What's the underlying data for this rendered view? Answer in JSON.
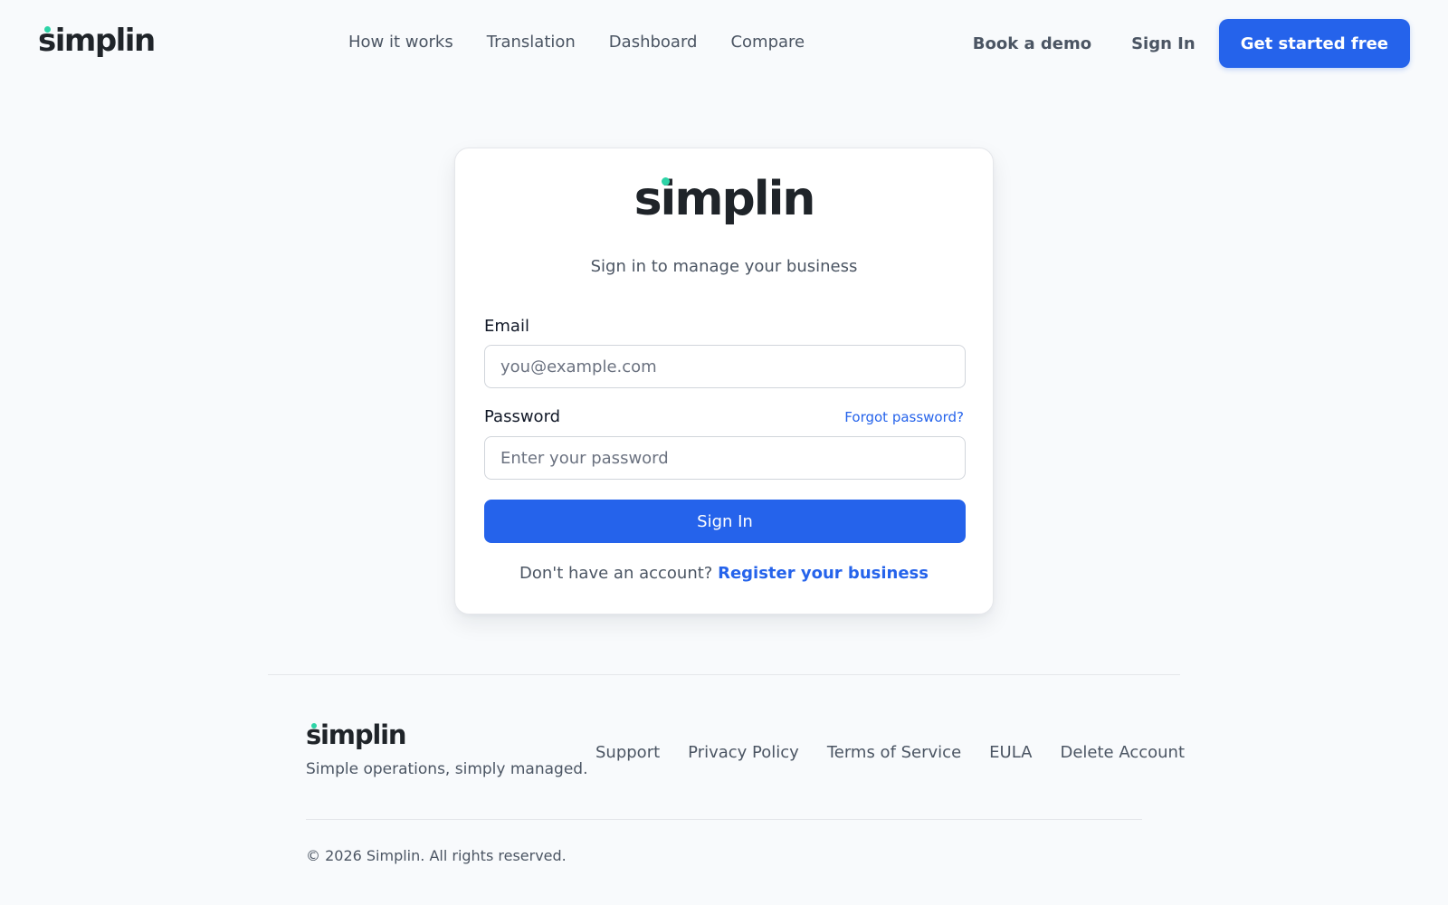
{
  "brand": {
    "logo_text": "simplin",
    "accent_dot_color": "#2dd4a7",
    "primary_color": "#2563eb"
  },
  "header": {
    "nav": [
      {
        "label": "How it works"
      },
      {
        "label": "Translation"
      },
      {
        "label": "Dashboard"
      },
      {
        "label": "Compare"
      }
    ],
    "book_demo": "Book a demo",
    "sign_in": "Sign In",
    "cta": "Get started free"
  },
  "login": {
    "subtitle": "Sign in to manage your business",
    "email_label": "Email",
    "email_placeholder": "you@example.com",
    "password_label": "Password",
    "forgot_password": "Forgot password?",
    "password_placeholder": "Enter your password",
    "submit": "Sign In",
    "no_account_text": "Don't have an account?",
    "register_link": "Register your business"
  },
  "footer": {
    "tagline": "Simple operations, simply managed.",
    "links": [
      {
        "label": "Support"
      },
      {
        "label": "Privacy Policy"
      },
      {
        "label": "Terms of Service"
      },
      {
        "label": "EULA"
      },
      {
        "label": "Delete Account"
      }
    ],
    "copyright": "© 2026 Simplin. All rights reserved."
  }
}
